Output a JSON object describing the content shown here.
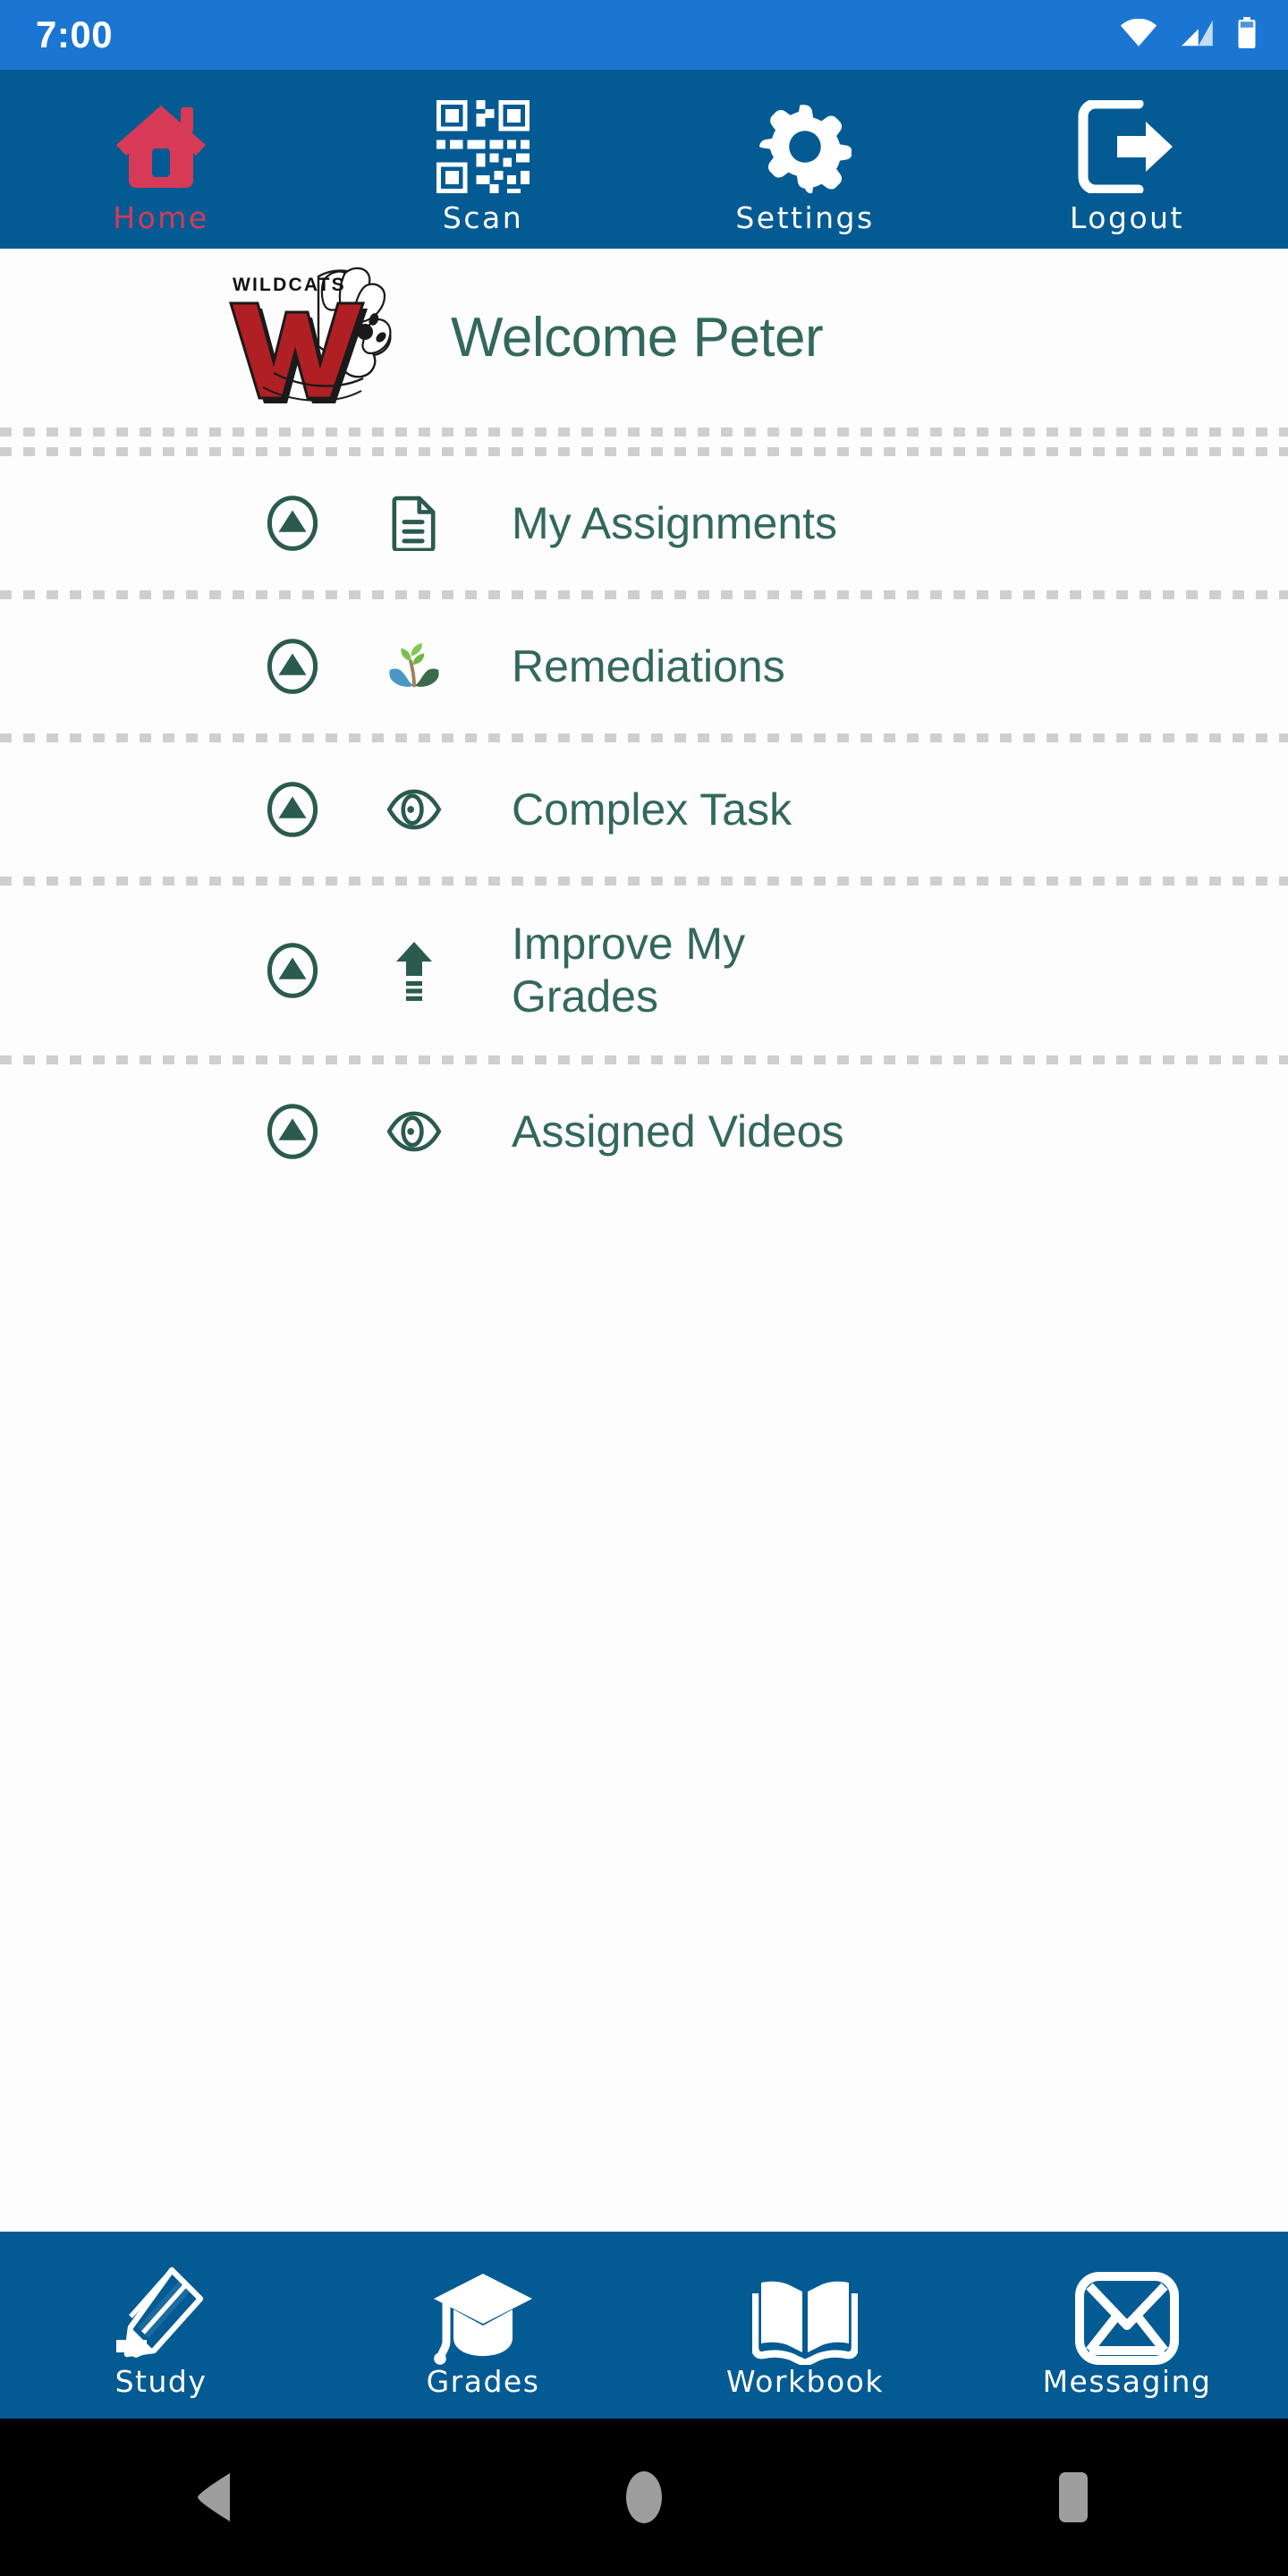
{
  "status_bar": {
    "time": "7:00",
    "icons": [
      "wifi-icon",
      "cellular-signal-icon",
      "battery-icon"
    ]
  },
  "top_nav": {
    "items": [
      {
        "label": "Home",
        "icon": "house-icon",
        "active": true
      },
      {
        "label": "Scan",
        "icon": "qr-code-icon",
        "active": false
      },
      {
        "label": "Settings",
        "icon": "gear-icon",
        "active": false
      },
      {
        "label": "Logout",
        "icon": "logout-icon",
        "active": false
      }
    ]
  },
  "header": {
    "logo_alt": "WILDCATS",
    "logo_word": "WILDCATS",
    "logo_letter": "W",
    "welcome": "Welcome Peter"
  },
  "menu": {
    "items": [
      {
        "label": "My Assignments",
        "icon": "document-icon",
        "toggle": "collapse-arrow-icon"
      },
      {
        "label": "Remediations",
        "icon": "sapling-hands-icon",
        "toggle": "collapse-arrow-icon"
      },
      {
        "label": "Complex Task",
        "icon": "eye-icon",
        "toggle": "collapse-arrow-icon"
      },
      {
        "label": "Improve My\nGrades",
        "icon": "up-arrow-icon",
        "toggle": "collapse-arrow-icon"
      },
      {
        "label": "Assigned Videos",
        "icon": "eye-icon",
        "toggle": "collapse-arrow-icon"
      }
    ]
  },
  "bottom_nav": {
    "items": [
      {
        "label": "Study",
        "icon": "pencil-icon"
      },
      {
        "label": "Grades",
        "icon": "graduation-cap-icon"
      },
      {
        "label": "Workbook",
        "icon": "open-book-icon"
      },
      {
        "label": "Messaging",
        "icon": "envelope-icon"
      }
    ]
  },
  "system_bar": {
    "buttons": [
      {
        "name": "back-button",
        "icon": "triangle-left-icon"
      },
      {
        "name": "home-button",
        "icon": "circle-icon"
      },
      {
        "name": "recents-button",
        "icon": "square-icon"
      }
    ]
  },
  "colors": {
    "status_bar": "#1a76d2",
    "nav_bar": "#045b94",
    "accent_red": "#d63a56",
    "text_green": "#33685c",
    "logo_red": "#b01f24",
    "separator": "#cfcfcf"
  }
}
